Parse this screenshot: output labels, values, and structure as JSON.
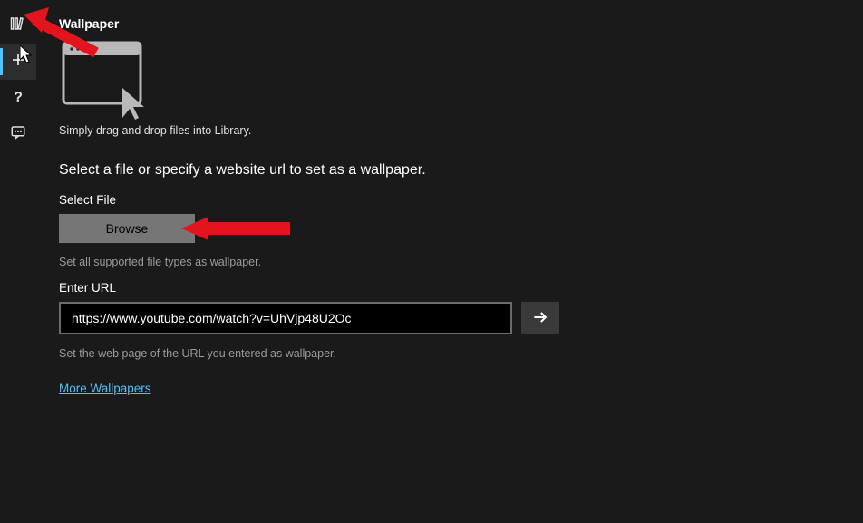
{
  "sidebar": {
    "items": [
      {
        "name": "library"
      },
      {
        "name": "add"
      },
      {
        "name": "help"
      },
      {
        "name": "feedback"
      }
    ]
  },
  "page": {
    "title": "Wallpaper",
    "drop_caption": "Simply drag and drop files into Library.",
    "instruction": "Select a file or specify a website url to set as a wallpaper."
  },
  "file": {
    "label": "Select File",
    "browse": "Browse",
    "help": "Set all supported file types as wallpaper."
  },
  "url": {
    "label": "Enter URL",
    "value": "https://www.youtube.com/watch?v=UhVjp48U2Oc",
    "help": "Set the web page of the URL you entered as wallpaper."
  },
  "links": {
    "more": "More Wallpapers"
  }
}
